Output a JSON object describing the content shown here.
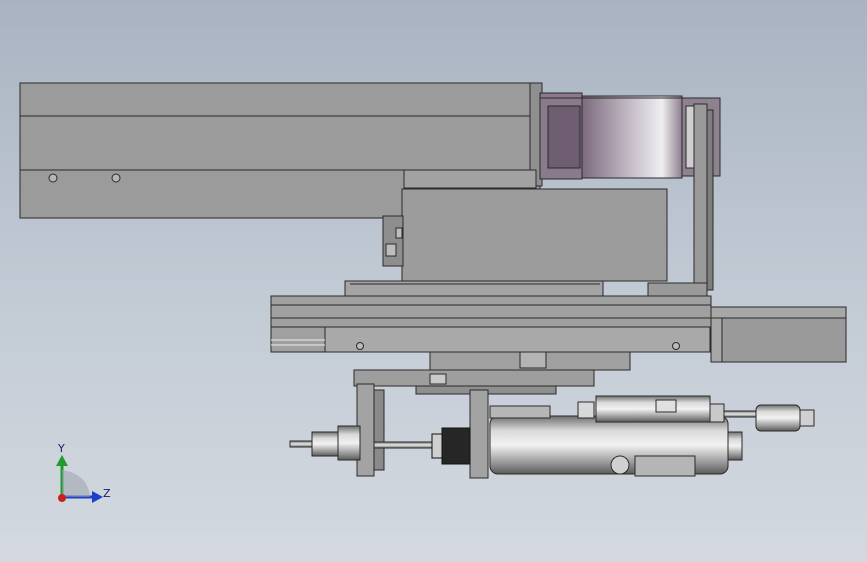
{
  "viewport": {
    "background_top": "#a9b4c2",
    "background_bottom": "#d4d9e0"
  },
  "model": {
    "part_fill": "#9e9e9e",
    "part_stroke": "#2a2a2a",
    "accent_purple": "#8a7a8c"
  },
  "triad": {
    "y_label": "Y",
    "z_label": "Z",
    "y_color": "#1f9a2e",
    "z_color": "#1f3fc8",
    "x_color": "#c81f1f"
  }
}
